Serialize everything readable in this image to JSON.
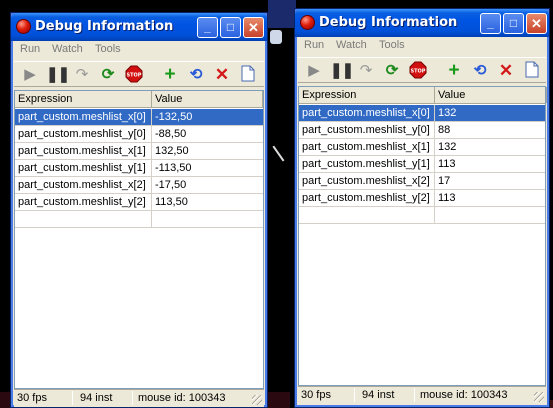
{
  "colors": {
    "titlebar": "#0054e3",
    "window_bg": "#ece9d8",
    "selection": "#316ac5"
  },
  "windows": [
    {
      "title": "Debug Information",
      "menu": [
        "Run",
        "Watch",
        "Tools"
      ],
      "toolbar_icons": [
        "play-icon",
        "pause-icon",
        "step-icon",
        "refresh-icon",
        "stop-icon",
        "add-icon",
        "sync-icon",
        "delete-icon",
        "page-icon"
      ],
      "columns": [
        "Expression",
        "Value"
      ],
      "rows": [
        {
          "expression": "part_custom.meshlist_x[0]",
          "value": "-132,50",
          "selected": true
        },
        {
          "expression": "part_custom.meshlist_y[0]",
          "value": "-88,50"
        },
        {
          "expression": "part_custom.meshlist_x[1]",
          "value": "132,50"
        },
        {
          "expression": "part_custom.meshlist_y[1]",
          "value": "-113,50"
        },
        {
          "expression": "part_custom.meshlist_x[2]",
          "value": "-17,50"
        },
        {
          "expression": "part_custom.meshlist_y[2]",
          "value": "113,50"
        }
      ],
      "status": {
        "fps": "30 fps",
        "inst": "94 inst",
        "mouse": "mouse id: 100343"
      }
    },
    {
      "title": "Debug Information",
      "menu": [
        "Run",
        "Watch",
        "Tools"
      ],
      "toolbar_icons": [
        "play-icon",
        "pause-icon",
        "step-icon",
        "refresh-icon",
        "stop-icon",
        "add-icon",
        "sync-icon",
        "delete-icon",
        "page-icon"
      ],
      "columns": [
        "Expression",
        "Value"
      ],
      "rows": [
        {
          "expression": "part_custom.meshlist_x[0]",
          "value": "132",
          "selected": true
        },
        {
          "expression": "part_custom.meshlist_y[0]",
          "value": "88"
        },
        {
          "expression": "part_custom.meshlist_x[1]",
          "value": "132"
        },
        {
          "expression": "part_custom.meshlist_y[1]",
          "value": "113"
        },
        {
          "expression": "part_custom.meshlist_x[2]",
          "value": "17"
        },
        {
          "expression": "part_custom.meshlist_y[2]",
          "value": "113"
        }
      ],
      "status": {
        "fps": "30 fps",
        "inst": "94 inst",
        "mouse": "mouse id: 100343"
      }
    }
  ]
}
